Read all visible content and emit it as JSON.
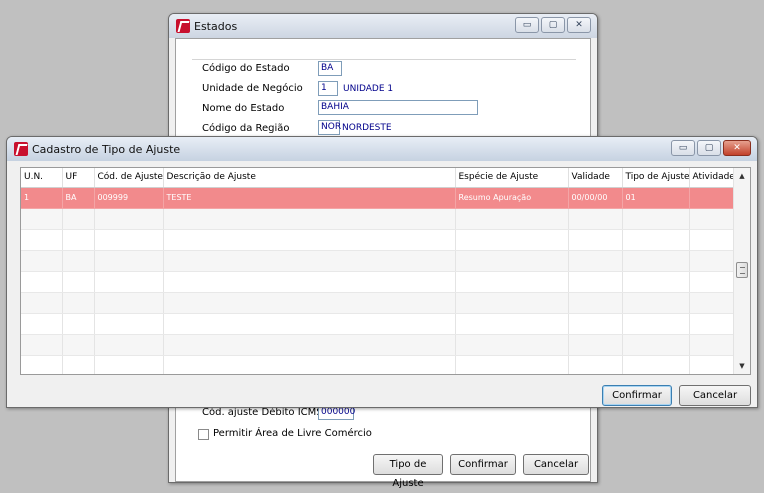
{
  "estados_window": {
    "title": "Estados",
    "fields": {
      "codigo_estado_label": "Código do Estado",
      "codigo_estado_value": "BA",
      "unidade_negocio_label": "Unidade de Negócio",
      "unidade_negocio_value": "1",
      "unidade_negocio_desc": "UNIDADE 1",
      "nome_estado_label": "Nome do Estado",
      "nome_estado_value": "BAHIA",
      "codigo_regiao_label": "Código da Região",
      "codigo_regiao_value": "NOR",
      "codigo_regiao_desc": "NORDESTE"
    },
    "cod_ajuste_label": "Cód. ajuste Débito ICMS",
    "cod_ajuste_value": "000000",
    "checkbox_label": "Permitir Área de Livre Comércio",
    "buttons": {
      "tipo_ajuste": "Tipo de Ajuste",
      "confirmar": "Confirmar",
      "cancelar": "Cancelar"
    }
  },
  "cadastro_window": {
    "title": "Cadastro de Tipo de Ajuste",
    "columns": [
      "U.N.",
      "UF",
      "Cód. de Ajuste",
      "Descrição de Ajuste",
      "Espécie de Ajuste",
      "Validade",
      "Tipo de Ajuste",
      "Atividade"
    ],
    "rows": [
      [
        "1",
        "BA",
        "009999",
        "TESTE",
        "Resumo Apuração",
        "00/00/00",
        "01",
        ""
      ]
    ],
    "buttons": {
      "confirmar": "Confirmar",
      "cancelar": "Cancelar"
    }
  },
  "window_controls": {
    "minimize": "▭",
    "maximize": "▢",
    "close": "✕"
  },
  "colors": {
    "selected_row": "#f28a8c",
    "brand_icon": "#c8102e",
    "value_text": "#00008b"
  }
}
